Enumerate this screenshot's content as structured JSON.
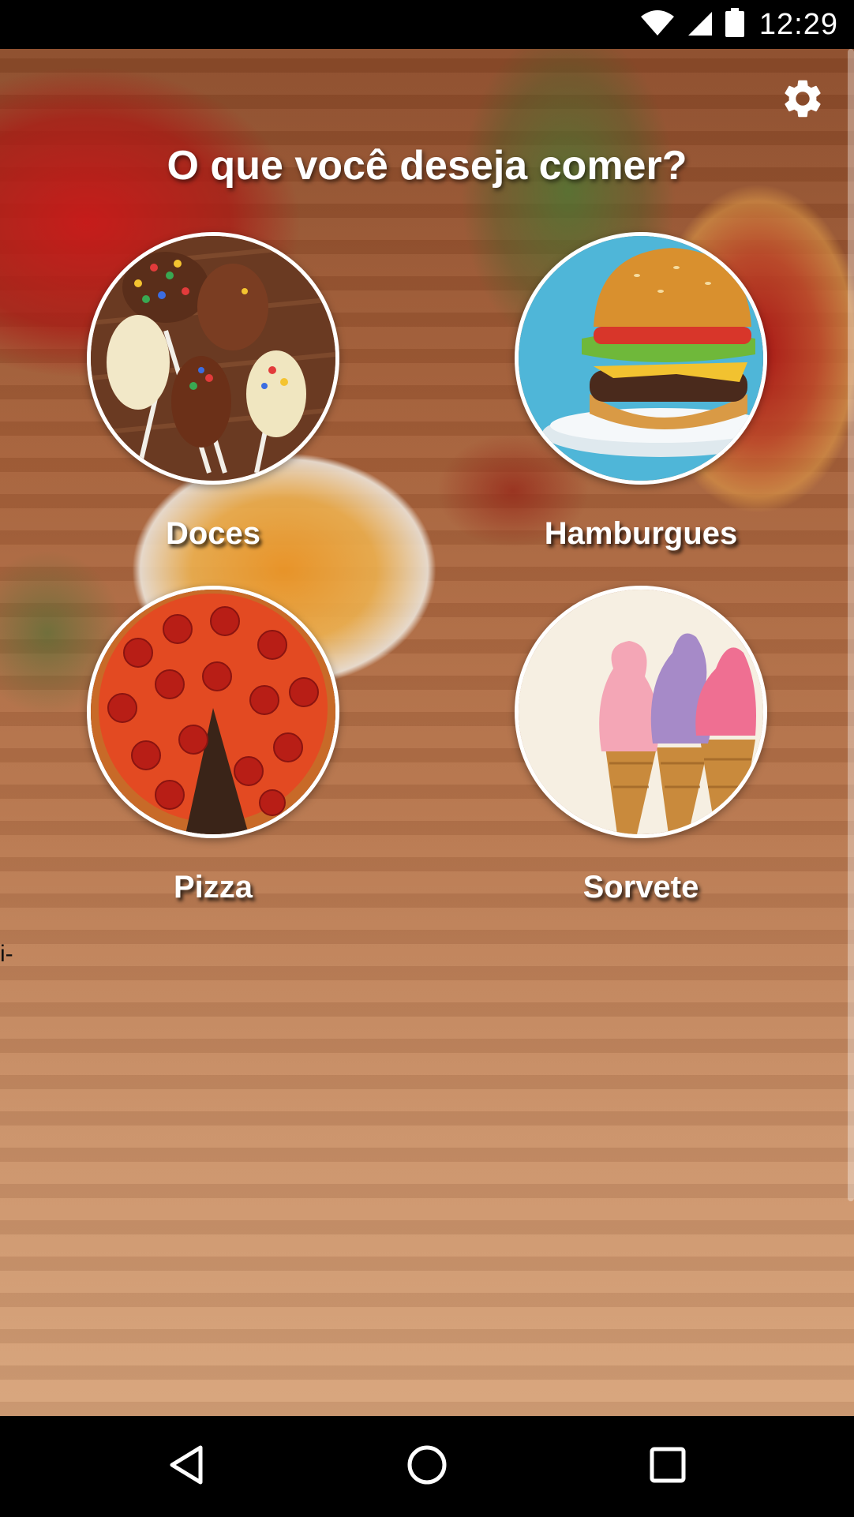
{
  "status_bar": {
    "time": "12:29",
    "icons": [
      "wifi-icon",
      "signal-icon",
      "battery-icon"
    ]
  },
  "header": {
    "title": "O que você deseja comer?",
    "settings_icon": "gear-icon"
  },
  "categories": [
    {
      "label": "Doces",
      "image": "cake-pops"
    },
    {
      "label": "Hamburgues",
      "image": "burger"
    },
    {
      "label": "Pizza",
      "image": "pepperoni-pizza"
    },
    {
      "label": "Sorvete",
      "image": "ice-cream-cones"
    }
  ],
  "stray_text": "i-",
  "nav_bar": {
    "buttons": [
      "back-icon",
      "home-icon",
      "recents-icon"
    ]
  },
  "colors": {
    "title_text": "#ffffff",
    "status_bar_bg": "#000000",
    "nav_bar_bg": "#000000"
  }
}
